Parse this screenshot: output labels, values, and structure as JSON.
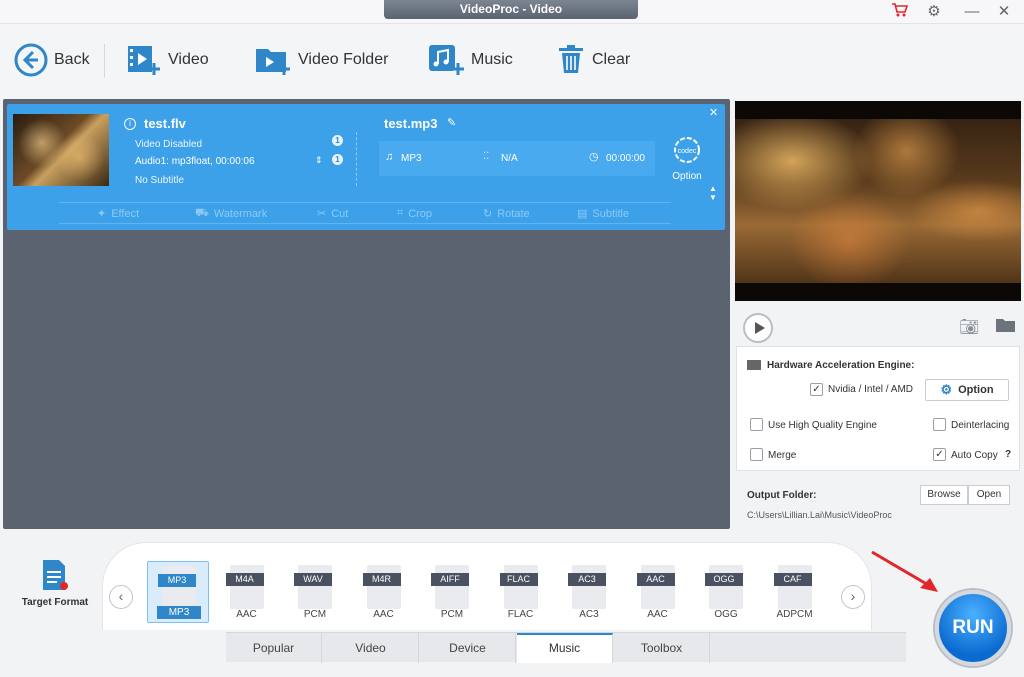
{
  "window": {
    "title": "VideoProc - Video"
  },
  "toolbar": {
    "back": "Back",
    "video": "Video",
    "video_folder": "Video Folder",
    "music": "Music",
    "clear": "Clear"
  },
  "task": {
    "source_name": "test.flv",
    "video_info": "Video Disabled",
    "audio_info": "Audio1: mp3float, 00:00:06",
    "subtitle_info": "No Subtitle",
    "count_video": "1",
    "count_audio": "1",
    "output_name": "test.mp3",
    "out_format": "MP3",
    "out_resolution": "N/A",
    "out_duration": "00:00:00",
    "codec_label": "codec",
    "option_label": "Option",
    "edit": {
      "effect": "Effect",
      "watermark": "Watermark",
      "cut": "Cut",
      "crop": "Crop",
      "rotate": "Rotate",
      "subtitle": "Subtitle"
    }
  },
  "settings": {
    "hw_title": "Hardware Acceleration Engine:",
    "nvidia": "Nvidia / Intel / AMD",
    "option_btn": "Option",
    "high_quality": "Use High Quality Engine",
    "deinterlacing": "Deinterlacing",
    "merge": "Merge",
    "auto_copy": "Auto Copy",
    "help": "?",
    "output_folder_label": "Output Folder:",
    "output_folder_path": "C:\\Users\\Lillian.Lai\\Music\\VideoProc",
    "browse": "Browse",
    "open": "Open"
  },
  "target": {
    "label": "Target Format"
  },
  "formats": [
    {
      "tag": "MP3",
      "sub": "MP3",
      "selected": true
    },
    {
      "tag": "M4A",
      "sub": "AAC"
    },
    {
      "tag": "WAV",
      "sub": "PCM"
    },
    {
      "tag": "M4R",
      "sub": "AAC"
    },
    {
      "tag": "AIFF",
      "sub": "PCM"
    },
    {
      "tag": "FLAC",
      "sub": "FLAC"
    },
    {
      "tag": "AC3",
      "sub": "AC3"
    },
    {
      "tag": "AAC",
      "sub": "AAC"
    },
    {
      "tag": "OGG",
      "sub": "OGG"
    },
    {
      "tag": "CAF",
      "sub": "ADPCM"
    }
  ],
  "tabs": [
    "Popular",
    "Video",
    "Device",
    "Music",
    "Toolbox"
  ],
  "active_tab": "Music",
  "run_label": "RUN",
  "colors": {
    "accent": "#2f86c8",
    "task_bg": "#3da1ea",
    "arrow": "#e3262b"
  }
}
